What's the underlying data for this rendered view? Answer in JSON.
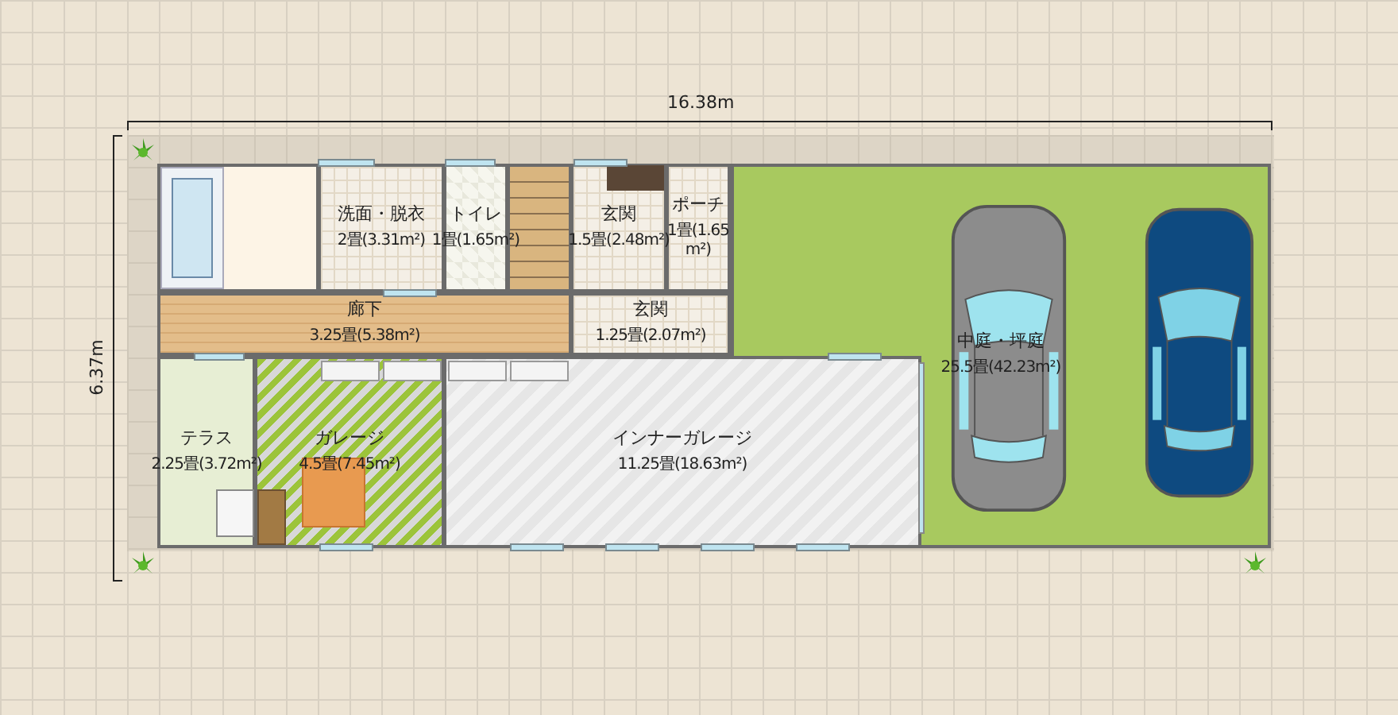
{
  "dimensions": {
    "width": "16.38m",
    "depth": "6.37m"
  },
  "rooms": [
    {
      "kind": "tile",
      "label": "洗面・脱衣",
      "area": "2畳(3.31m²)"
    },
    {
      "kind": "checker",
      "label": "トイレ",
      "area": "1畳(1.65m²)"
    },
    {
      "kind": "tile",
      "label": "玄関",
      "area": "1.5畳(2.48m²)"
    },
    {
      "kind": "tile",
      "label": "ポーチ",
      "area": "1畳(1.65m²)"
    },
    {
      "kind": "wood",
      "label": "廊下",
      "area": "3.25畳(5.38m²)"
    },
    {
      "kind": "tile",
      "label": "玄関",
      "area": "1.25畳(2.07m²)"
    },
    {
      "kind": "lawn",
      "label": "中庭・坪庭",
      "area": "25.5畳(42.23m²)"
    },
    {
      "kind": "terrace",
      "label": "テラス",
      "area": "2.25畳(3.72m²)"
    },
    {
      "kind": "zigzag_green",
      "label": "ガレージ",
      "area": "4.5畳(7.45m²)"
    },
    {
      "kind": "zigzag_gray",
      "label": "インナーガレージ",
      "area": "11.25畳(18.63m²)"
    }
  ]
}
